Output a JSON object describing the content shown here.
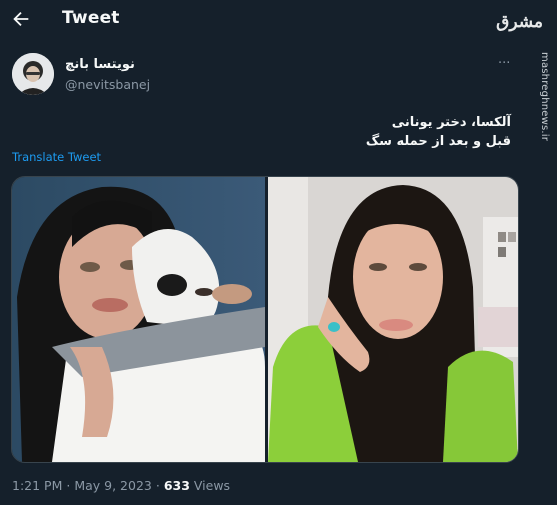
{
  "header": {
    "title": "Tweet"
  },
  "watermark": {
    "logo": "مشرق",
    "url": "mashreghnews.ir"
  },
  "author": {
    "display_name": "نویتسا بانچ",
    "handle": "@nevitsbanej"
  },
  "more_label": "···",
  "tweet": {
    "line1": "آلکسا، دختر یونانی",
    "line2": "قبل و بعد از حمله سگ"
  },
  "translate_label": "Translate Tweet",
  "meta": {
    "time": "1:21 PM",
    "sep1": "·",
    "date": "May 9, 2023",
    "sep2": "·",
    "views_count": "633",
    "views_label": "Views"
  }
}
